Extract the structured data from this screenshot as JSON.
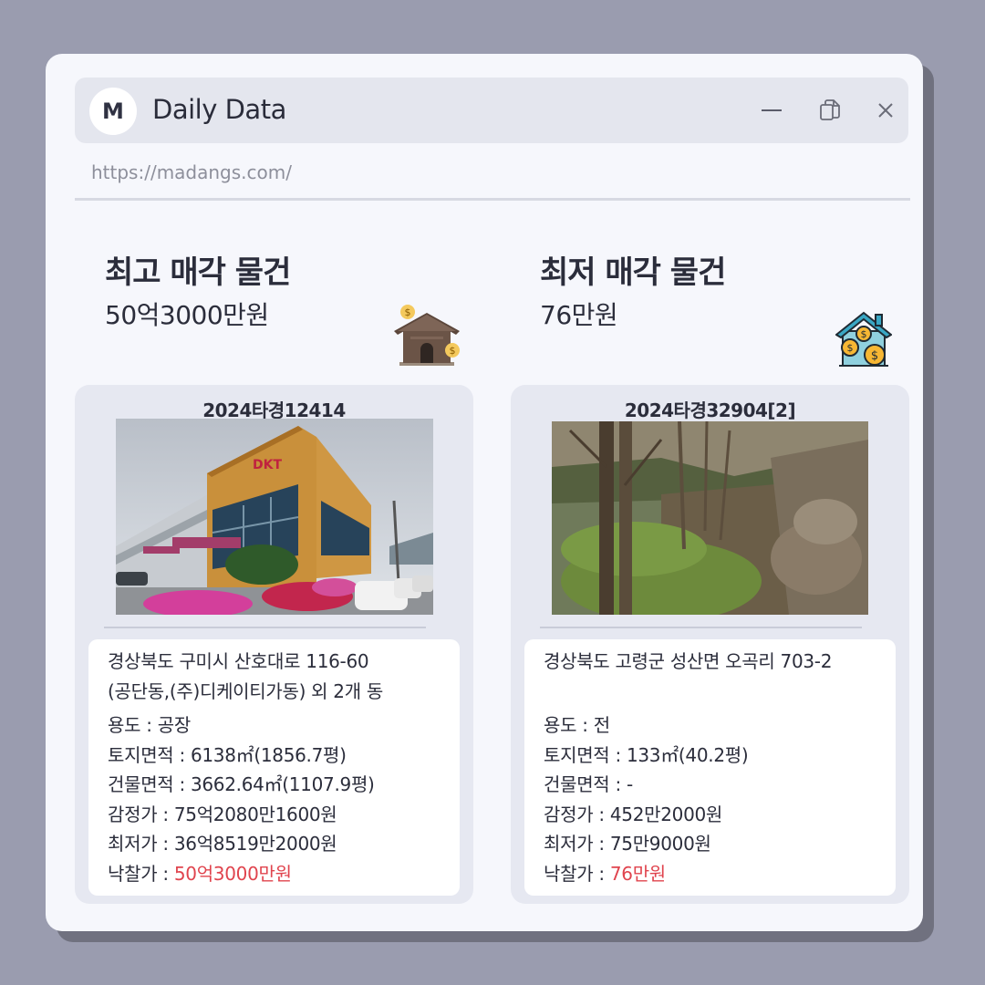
{
  "window": {
    "logo_letter": "M",
    "title": "Daily Data",
    "url": "https://madangs.com/"
  },
  "left": {
    "heading": "최고 매각 물건",
    "price": "50억3000만원",
    "icon": "house-money-icon",
    "case_number": "2024타경12414",
    "photo": "factory-building-photo",
    "address_line1": "경상북도 구미시 산호대로 116-60",
    "address_line2": "(공단동,(주)디케이티가동) 외 2개 동",
    "usage_label": "용도 : ",
    "usage": "공장",
    "land_label": "토지면적 : ",
    "land_area": "6138㎡(1856.7평)",
    "building_label": "건물면적 : ",
    "building_area": "3662.64㎡(1107.9평)",
    "appraisal_label": "감정가 : ",
    "appraisal": "75억2080만1600원",
    "minimum_label": "최저가 : ",
    "minimum": "36억8519만2000원",
    "winning_label": "낙찰가 : ",
    "winning": "50억3000만원"
  },
  "right": {
    "heading": "최저 매각 물건",
    "price": "76만원",
    "icon": "house-coins-icon",
    "case_number": "2024타경32904[2]",
    "photo": "wooded-field-photo",
    "address_line1": "경상북도 고령군 성산면 오곡리 703-2",
    "address_line2": "",
    "usage_label": "용도 : ",
    "usage": "전",
    "land_label": "토지면적 : ",
    "land_area": "133㎡(40.2평)",
    "building_label": "건물면적 : ",
    "building_area": "-",
    "appraisal_label": "감정가 : ",
    "appraisal": "452만2000원",
    "minimum_label": "최저가 : ",
    "minimum": "75만9000원",
    "winning_label": "낙찰가 : ",
    "winning": "76만원"
  },
  "colors": {
    "background": "#9a9caf",
    "window": "#f6f7fc",
    "titlebar": "#e4e6ee",
    "card": "#e6e8f1",
    "accent": "#e0444e"
  }
}
